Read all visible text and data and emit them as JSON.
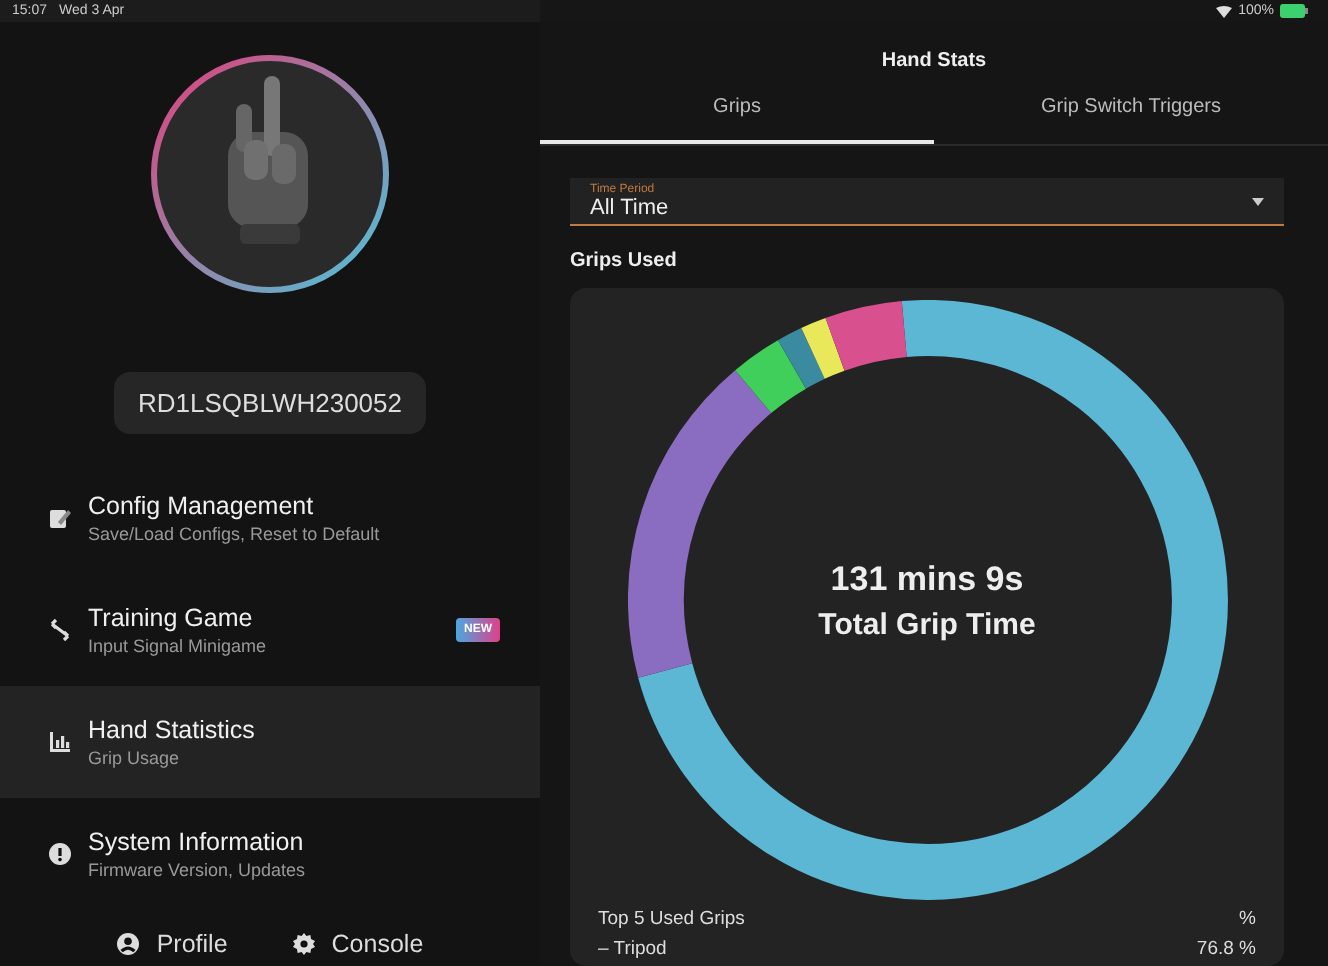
{
  "status_bar": {
    "time": "15:07",
    "date": "Wed 3 Apr",
    "battery": "100%"
  },
  "sidebar": {
    "serial": "RD1LSQBLWH230052",
    "items": [
      {
        "title": "Config Management",
        "subtitle": "Save/Load Configs, Reset to Default",
        "selected": false
      },
      {
        "title": "Training Game",
        "subtitle": "Input Signal Minigame",
        "badge": "NEW",
        "selected": false
      },
      {
        "title": "Hand Statistics",
        "subtitle": "Grip Usage",
        "selected": true
      },
      {
        "title": "System Information",
        "subtitle": "Firmware Version, Updates",
        "selected": false
      }
    ],
    "footer_buttons": [
      "Profile",
      "Console"
    ]
  },
  "main": {
    "title": "Hand Stats",
    "tabs": [
      {
        "label": "Grips",
        "selected": true
      },
      {
        "label": "Grip Switch Triggers",
        "selected": false
      }
    ],
    "time_period": {
      "label": "Time Period",
      "value": "All Time"
    },
    "section_title": "Grips Used",
    "donut_center": {
      "value": "131 mins 9s",
      "label": "Total Grip Time"
    },
    "top_grips": {
      "heading": "Top 5 Used Grips",
      "unit": "%",
      "rows": [
        {
          "name": "– Tripod",
          "value": "76.8 %"
        }
      ]
    }
  }
}
